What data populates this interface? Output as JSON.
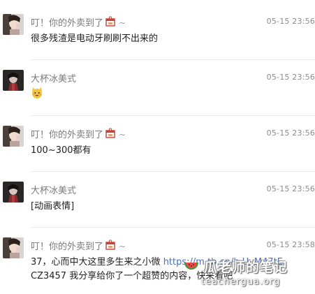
{
  "messages": [
    {
      "sender": "叮！你的外卖到了",
      "sender_emoji": "takeout-box-emoji",
      "suffix": "~",
      "time": "05-15 23:56",
      "text": "很多残渣是电动牙刷刷不出来的"
    },
    {
      "sender": "大杯冰美式",
      "time": "05-15 23:56",
      "sticker": "cat-face-emoji"
    },
    {
      "sender": "叮！你的外卖到了",
      "sender_emoji": "takeout-box-emoji",
      "suffix": "~",
      "time": "05-15 23:56",
      "text": "100~300都有"
    },
    {
      "sender": "大杯冰美式",
      "time": "05-15 23:56",
      "text": "[动画表情]"
    },
    {
      "sender": "叮！你的外卖到了",
      "sender_emoji": "takeout-box-emoji",
      "suffix": "~",
      "time": "05-15 23:58",
      "text_prefix": "37，心而中大这里多生来之小微 ",
      "link": "https://m.tb.cn/h.UvM47tE",
      "text_suffix": "CZ3457 我分享给你了一个超赞的内容，快来看吧"
    }
  ],
  "watermark": {
    "title": "瓜老师的笔记",
    "url": "teachergua.org"
  },
  "colors": {
    "name": "#7a7a7a",
    "time": "#8a8a8a",
    "text": "#222222",
    "link": "#4a72b8",
    "divider": "#ececec"
  }
}
